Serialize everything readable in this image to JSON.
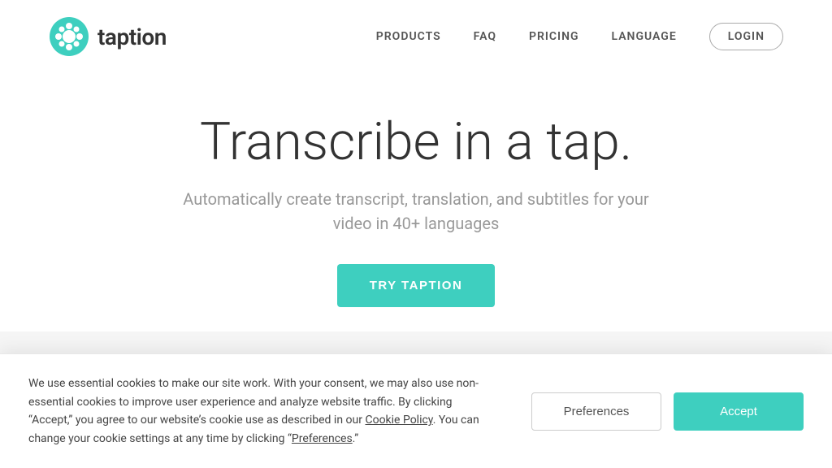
{
  "navbar": {
    "logo_text": "taption",
    "links": [
      {
        "label": "PRODUCTS",
        "name": "products"
      },
      {
        "label": "FAQ",
        "name": "faq"
      },
      {
        "label": "PRICING",
        "name": "pricing"
      },
      {
        "label": "LANGUAGE",
        "name": "language"
      }
    ],
    "login_label": "LOGIN"
  },
  "hero": {
    "title": "Transcribe in a tap.",
    "subtitle": "Automatically create transcript, translation, and subtitles for your video in 40+ languages",
    "cta_label": "TRY TAPTION"
  },
  "cookie_banner": {
    "text_part1": "We use essential cookies to make our site work. With your consent, we may also use non-essential cookies to improve user experience and analyze website traffic. By clicking “Accept,” you agree to our website’s cookie use as described in our ",
    "cookie_policy_link": "Cookie Policy",
    "text_part2": ". You can change your cookie settings at any time by clicking “",
    "preferences_link": "Preferences",
    "text_part3": ".”",
    "preferences_button": "Preferences",
    "accept_button": "Accept"
  },
  "colors": {
    "brand_teal": "#3ecfbf",
    "text_dark": "#333",
    "text_gray": "#999",
    "border_gray": "#ccc"
  }
}
